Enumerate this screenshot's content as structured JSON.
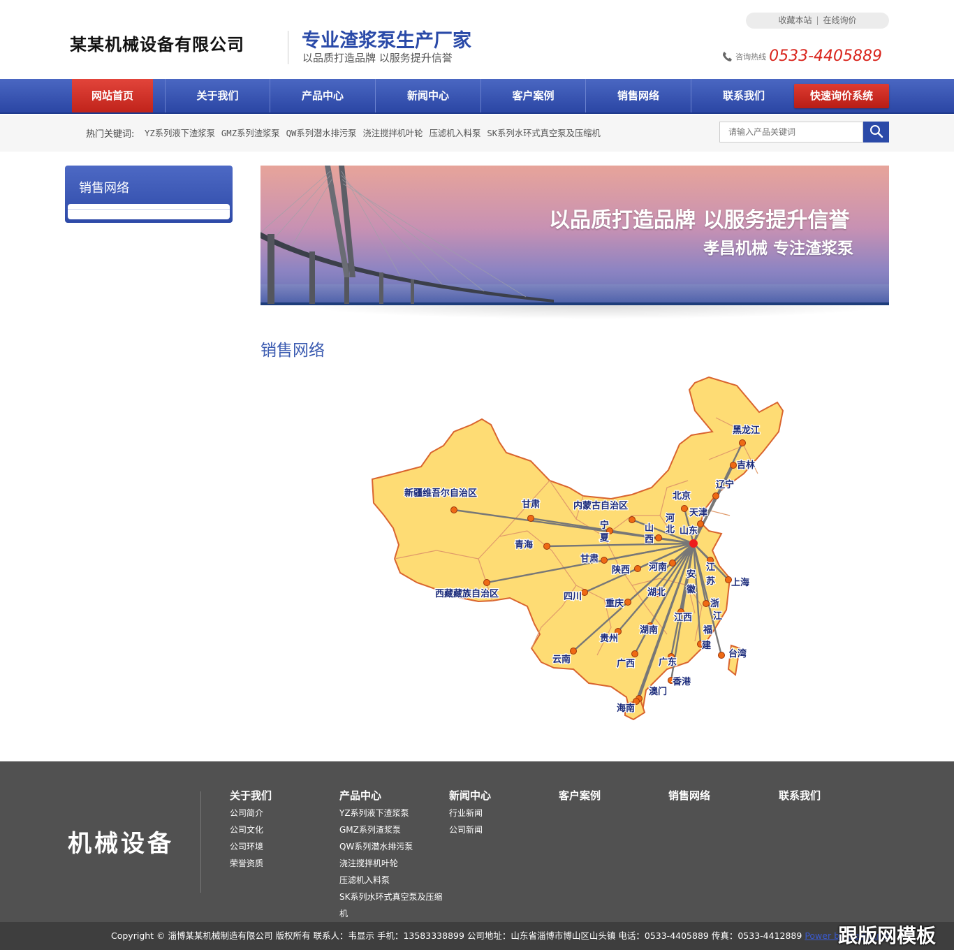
{
  "header": {
    "logo_text": "某某机械设备有限公司",
    "slogan_main": "专业渣浆泵生产厂家",
    "slogan_sub": "以品质打造品牌  以服务提升信誉",
    "top_links": [
      "收藏本站",
      "在线询价"
    ],
    "hotline_label": "咨询热线",
    "hotline_number": "0533-4405889"
  },
  "nav": {
    "items": [
      "网站首页",
      "关于我们",
      "产品中心",
      "新闻中心",
      "客户案例",
      "销售网络",
      "联系我们"
    ],
    "active_index": 0,
    "quote_button": "快速询价系统"
  },
  "keywords": {
    "label": "热门关键词:",
    "items": [
      "YZ系列液下渣浆泵",
      "GMZ系列渣浆泵",
      "QW系列潜水排污泵",
      "浇注搅拌机叶轮",
      "压滤机入料泵",
      "SK系列水环式真空泵及压缩机"
    ]
  },
  "search": {
    "placeholder": "请输入产品关键词",
    "icon": "search-icon"
  },
  "sidebar": {
    "title": "销售网络"
  },
  "banner": {
    "line1": "以品质打造品牌  以服务提升信誉",
    "line2": "孝昌机械  专注渣浆泵"
  },
  "page_title": "销售网络",
  "map": {
    "hub": "山东",
    "labels": [
      "黑龙江",
      "吉林",
      "辽宁",
      "北京",
      "天津",
      "河",
      "北",
      "山东",
      "内蒙古自治区",
      "新疆维吾尔自治区",
      "甘肃",
      "宁",
      "夏",
      "山",
      "西",
      "青海",
      "甘肃",
      "陕西",
      "河南",
      "安",
      "徽",
      "江",
      "苏",
      "上海",
      "西藏藏族自治区",
      "四川",
      "重庆",
      "湖北",
      "浙",
      "江",
      "江西",
      "贵州",
      "湖南",
      "福",
      "建",
      "台湾",
      "云南",
      "广西",
      "广东",
      "香港",
      "澳门",
      "海南"
    ]
  },
  "footer": {
    "logo": "机械设备",
    "columns": [
      {
        "title": "关于我们",
        "links": [
          "公司简介",
          "公司文化",
          "公司环境",
          "荣誉资质"
        ]
      },
      {
        "title": "产品中心",
        "links": [
          "YZ系列液下渣浆泵",
          "GMZ系列渣浆泵",
          "QW系列潜水排污泵",
          "浇注搅拌机叶轮",
          "压滤机入料泵",
          "SK系列水环式真空泵及压缩机"
        ]
      },
      {
        "title": "新闻中心",
        "links": [
          "行业新闻",
          "公司新闻"
        ]
      },
      {
        "title": "客户案例",
        "links": []
      },
      {
        "title": "销售网络",
        "links": []
      },
      {
        "title": "联系我们",
        "links": []
      }
    ],
    "copyright": "Copyright © 淄博某某机械制造有限公司 版权所有 联系人：韦显示 手机：13583338899 公司地址：山东省淄博市博山区山头镇 电话：0533-4405889 传真：0533-4412889 ",
    "powered_by": "Power by DedeCms",
    "watermark": "跟版网模板"
  }
}
